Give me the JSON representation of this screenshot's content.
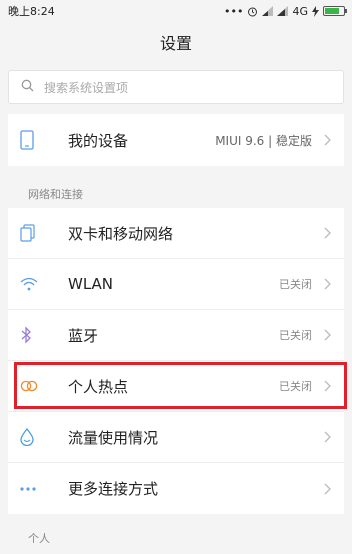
{
  "status": {
    "time": "晚上8:24",
    "icons": [
      "dots-icon",
      "alarm-icon",
      "signal-icon",
      "signal-icon",
      "4g-icon",
      "charging-icon",
      "battery-icon"
    ],
    "network": "4G"
  },
  "header": {
    "title": "设置"
  },
  "search": {
    "placeholder": "搜索系统设置项"
  },
  "device": {
    "label": "我的设备",
    "value": "MIUI 9.6 | 稳定版"
  },
  "section_network": {
    "title": "网络和连接"
  },
  "network_items": [
    {
      "label": "双卡和移动网络",
      "value": "",
      "icon": "sim-cards-icon"
    },
    {
      "label": "WLAN",
      "value": "已关闭",
      "icon": "wifi-icon"
    },
    {
      "label": "蓝牙",
      "value": "已关闭",
      "icon": "bluetooth-icon"
    },
    {
      "label": "个人热点",
      "value": "已关闭",
      "icon": "hotspot-icon"
    },
    {
      "label": "流量使用情况",
      "value": "",
      "icon": "data-usage-icon"
    },
    {
      "label": "更多连接方式",
      "value": "",
      "icon": "more-dots-icon"
    }
  ],
  "section_personal": {
    "title": "个人"
  },
  "colors": {
    "accent": "#5a9de6",
    "highlight": "#e0202a",
    "hotspot": "#f08a2c"
  }
}
